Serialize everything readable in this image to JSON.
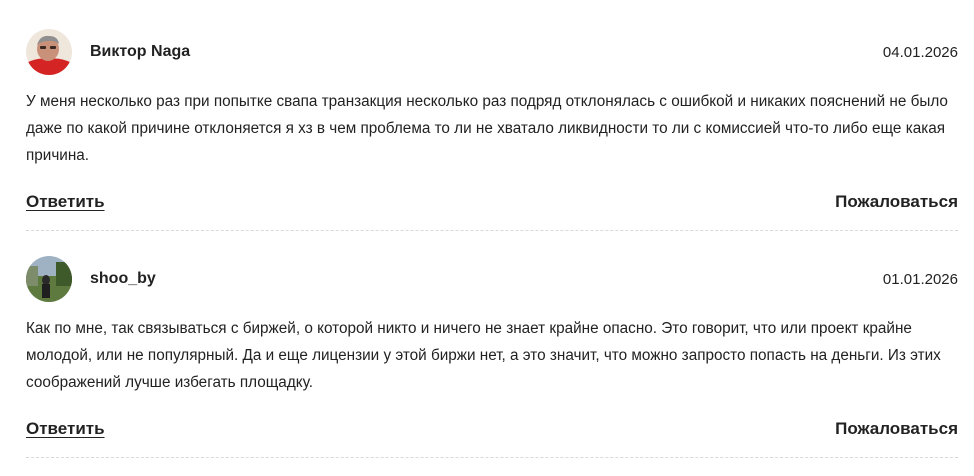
{
  "comments": [
    {
      "author": "Виктор Naga",
      "date": "04.01.2026",
      "text": "У меня несколько раз при попытке свапа транзакция несколько раз подряд отклонялась с ошибкой и никаких пояснений не было даже по какой причине отклоняется я хз в чем проблема то ли не хватало ликвидности то ли с комиссией что-то либо еще какая причина.",
      "reply_label": "Ответить",
      "report_label": "Пожаловаться",
      "avatar_icon": "user-photo-red-shirt"
    },
    {
      "author": "shoo_by",
      "date": "01.01.2026",
      "text": "Как по мне, так связываться с биржей, о которой никто и ничего не знает крайне опасно. Это говорит, что или проект крайне молодой, или не популярный. Да и еще лицензии у этой биржи нет, а это значит, что можно запросто попасть на деньги. Из этих соображений лучше избегать площадку.",
      "reply_label": "Ответить",
      "report_label": "Пожаловаться",
      "avatar_icon": "user-photo-outdoor"
    }
  ]
}
